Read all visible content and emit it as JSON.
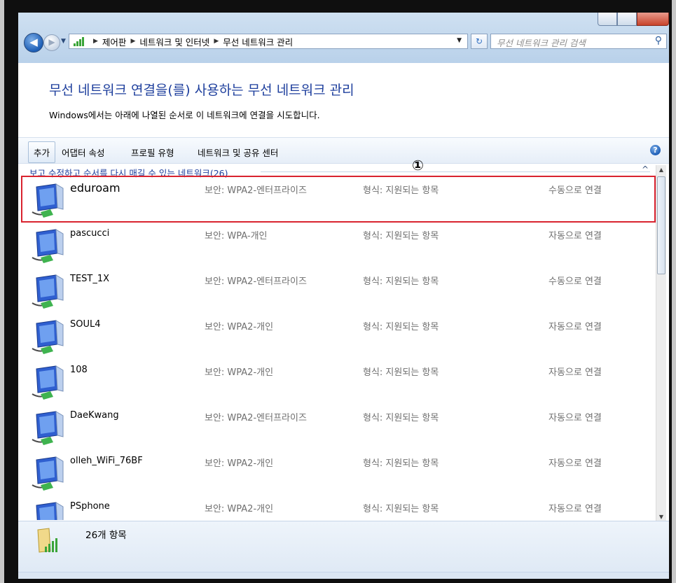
{
  "address": {
    "crumbs": [
      "제어판",
      "네트워크 및 인터넷",
      "무선 네트워크 관리"
    ],
    "search_placeholder": "무선 네트워크 관리 검색"
  },
  "page": {
    "heading": "무선 네트워크 연결을(를) 사용하는 무선 네트워크 관리",
    "subtext": "Windows에서는 아래에 나열된 순서로 이 네트워크에 연결을 시도합니다."
  },
  "toolbar": {
    "add": "추가",
    "adapter": "어댑터 속성",
    "profile_type": "프로필 유형",
    "network_center": "네트워크 및 공유 센터"
  },
  "group": {
    "title": "보고 수정하고 순서를 다시 매길 수 있는 네트워크(26)"
  },
  "annotation": "①",
  "networks": [
    {
      "name": "eduroam",
      "security": "보안: WPA2-엔터프라이즈",
      "format": "형식: 지원되는 항목",
      "mode": "수동으로 연결"
    },
    {
      "name": "pascucci",
      "security": "보안: WPA-개인",
      "format": "형식: 지원되는 항목",
      "mode": "자동으로 연결"
    },
    {
      "name": "TEST_1X",
      "security": "보안: WPA2-엔터프라이즈",
      "format": "형식: 지원되는 항목",
      "mode": "수동으로 연결"
    },
    {
      "name": "SOUL4",
      "security": "보안: WPA2-개인",
      "format": "형식: 지원되는 항목",
      "mode": "자동으로 연결"
    },
    {
      "name": "108",
      "security": "보안: WPA2-개인",
      "format": "형식: 지원되는 항목",
      "mode": "자동으로 연결"
    },
    {
      "name": "DaeKwang",
      "security": "보안: WPA2-엔터프라이즈",
      "format": "형식: 지원되는 항목",
      "mode": "자동으로 연결"
    },
    {
      "name": "olleh_WiFi_76BF",
      "security": "보안: WPA2-개인",
      "format": "형식: 지원되는 항목",
      "mode": "자동으로 연결"
    },
    {
      "name": "PSphone",
      "security": "보안: WPA2-개인",
      "format": "형식: 지원되는 항목",
      "mode": "자동으로 연결"
    }
  ],
  "status": {
    "count": "26개 항목"
  }
}
